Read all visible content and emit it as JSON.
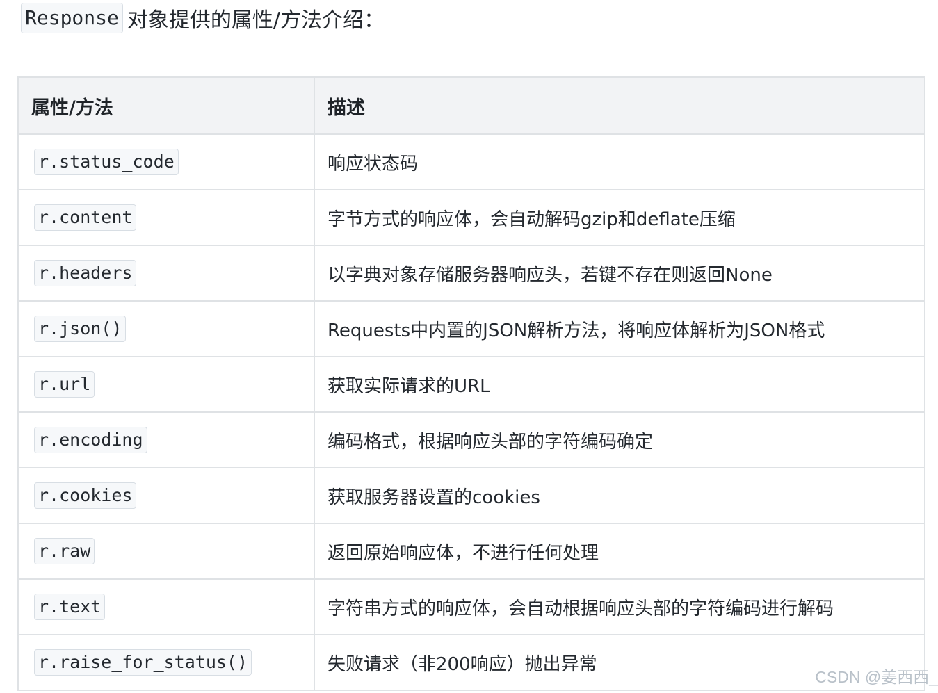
{
  "intro": {
    "code": "Response",
    "text": "对象提供的属性/方法介绍："
  },
  "table": {
    "headers": [
      "属性/方法",
      "描述"
    ],
    "rows": [
      {
        "prop": "r.status_code",
        "desc": "响应状态码"
      },
      {
        "prop": "r.content",
        "desc": "字节方式的响应体，会自动解码gzip和deflate压缩"
      },
      {
        "prop": "r.headers",
        "desc": "以字典对象存储服务器响应头，若键不存在则返回None"
      },
      {
        "prop": "r.json()",
        "desc": "Requests中内置的JSON解析方法，将响应体解析为JSON格式"
      },
      {
        "prop": "r.url",
        "desc": "获取实际请求的URL"
      },
      {
        "prop": "r.encoding",
        "desc": "编码格式，根据响应头部的字符编码确定"
      },
      {
        "prop": "r.cookies",
        "desc": "获取服务器设置的cookies"
      },
      {
        "prop": "r.raw",
        "desc": "返回原始响应体，不进行任何处理"
      },
      {
        "prop": "r.text",
        "desc": "字符串方式的响应体，会自动根据响应头部的字符编码进行解码"
      },
      {
        "prop": "r.raise_for_status()",
        "desc": "失败请求（非200响应）抛出异常"
      }
    ]
  },
  "footer": {
    "credit": "CSDN @姜西西_"
  }
}
